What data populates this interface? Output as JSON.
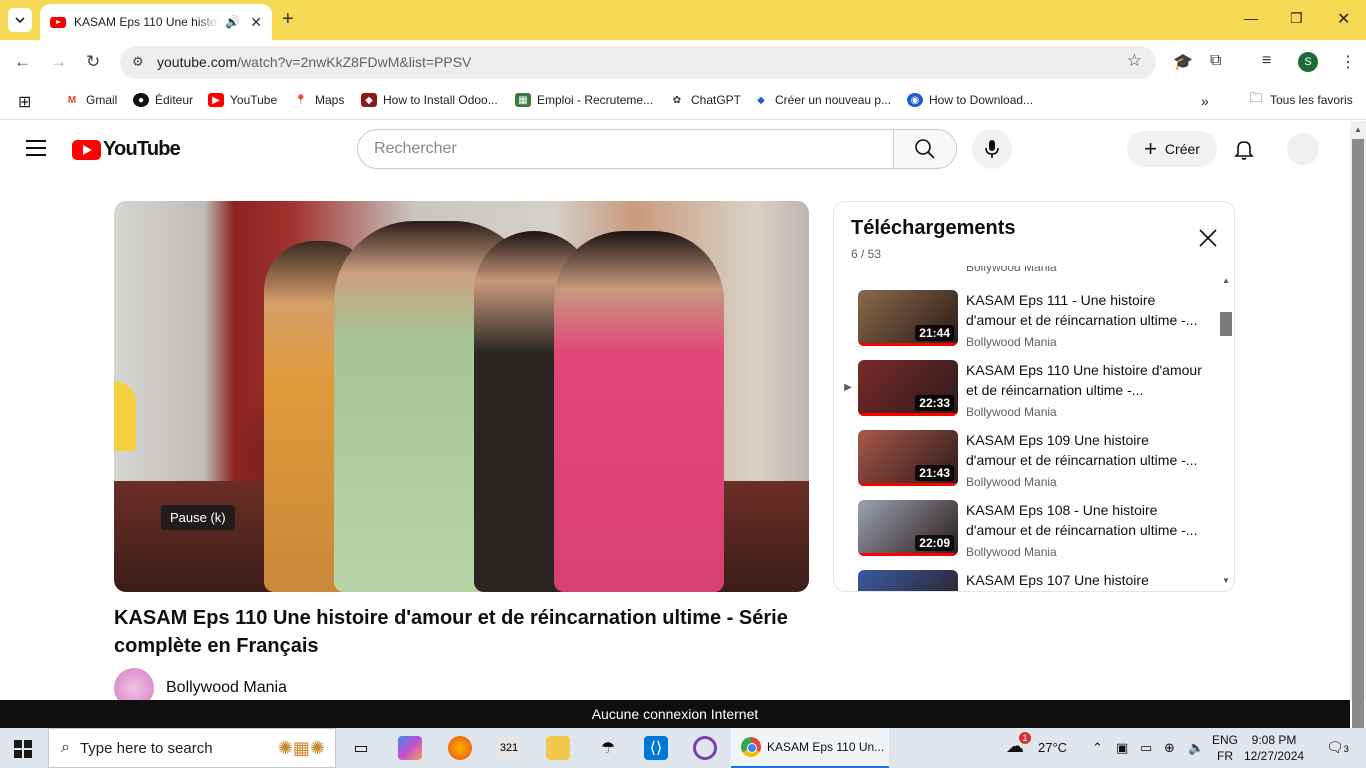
{
  "browser": {
    "tab": {
      "title": "KASAM Eps 110 Une histoire d'amour",
      "audio_icon": "speaker-icon"
    },
    "url_host": "youtube.com",
    "url_path": "/watch?v=2nwKkZ8FDwM&list=PPSV",
    "profile_initial": "S",
    "bookmarks": [
      {
        "label": "Gmail",
        "icon": "gmail-icon",
        "color": "#ea4335"
      },
      {
        "label": "Éditeur",
        "icon": "editor-icon",
        "color": "#000000"
      },
      {
        "label": "YouTube",
        "icon": "youtube-icon",
        "color": "#ff0000"
      },
      {
        "label": "Maps",
        "icon": "maps-icon",
        "color": "#34a853"
      },
      {
        "label": "How to Install Odoo...",
        "icon": "odoo-icon",
        "color": "#8b1a1a"
      },
      {
        "label": "Emploi - Recruteme...",
        "icon": "emploi-icon",
        "color": "#3a7a3a"
      },
      {
        "label": "ChatGPT",
        "icon": "chatgpt-icon",
        "color": "#333333"
      },
      {
        "label": "Créer un nouveau p...",
        "icon": "diamond-icon",
        "color": "#1a5fd6"
      },
      {
        "label": "How to Download...",
        "icon": "globe-icon",
        "color": "#1a5fd6"
      }
    ],
    "all_bookmarks_label": "Tous les favoris"
  },
  "youtube": {
    "logo_text": "YouTube",
    "search_placeholder": "Rechercher",
    "create_label": "Créer",
    "video": {
      "pause_tooltip": "Pause (k)",
      "title": "KASAM Eps 110 Une histoire d'amour et de réincarnation ultime - Série complète en Français",
      "channel": "Bollywood Mania"
    },
    "playlist": {
      "title": "Téléchargements",
      "position": "6 / 53",
      "top_partial_channel": "Bollywood Mania",
      "items": [
        {
          "index": "",
          "title": "KASAM Eps 111 - Une histoire d'amour et de réincarnation ultime -...",
          "channel": "Bollywood Mania",
          "duration": "21:44",
          "thumb": "#8a6a4a"
        },
        {
          "index": "▶",
          "title": "KASAM Eps 110 Une histoire d'amour et de réincarnation ultime -...",
          "channel": "Bollywood Mania",
          "duration": "22:33",
          "thumb": "#7a2a2a"
        },
        {
          "index": "",
          "title": "KASAM Eps 109 Une histoire d'amour et de réincarnation ultime -...",
          "channel": "Bollywood Mania",
          "duration": "21:43",
          "thumb": "#a8584a"
        },
        {
          "index": "",
          "title": "KASAM Eps 108 - Une histoire d'amour et de réincarnation ultime -...",
          "channel": "Bollywood Mania",
          "duration": "22:09",
          "thumb": "#9aa3b0"
        },
        {
          "index": "",
          "title": "KASAM Eps 107 Une histoire",
          "channel": "",
          "duration": "",
          "thumb": "#3a5aa0"
        }
      ]
    }
  },
  "offline_banner": "Aucune connexion Internet",
  "taskbar": {
    "search_placeholder": "Type here to search",
    "active_app_label": "KASAM Eps 110 Un...",
    "weather": "27°C",
    "lang_top": "ENG",
    "lang_bottom": "FR",
    "time": "9:08 PM",
    "date": "12/27/2024",
    "notification_count": "3",
    "weather_badge": "1"
  }
}
